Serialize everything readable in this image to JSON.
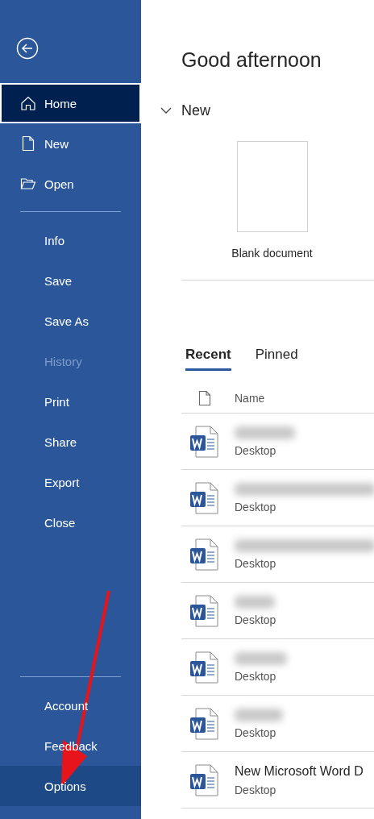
{
  "sidebar": {
    "back": {
      "kind": "back"
    },
    "top_items": [
      {
        "label": "Home",
        "selected": true,
        "disabled": false,
        "hovered": false
      },
      {
        "label": "New",
        "selected": false,
        "disabled": false,
        "hovered": false
      },
      {
        "label": "Open",
        "selected": false,
        "disabled": false,
        "hovered": false
      }
    ],
    "middle_items": [
      {
        "label": "Info",
        "selected": false,
        "disabled": false,
        "hovered": false
      },
      {
        "label": "Save",
        "selected": false,
        "disabled": false,
        "hovered": false
      },
      {
        "label": "Save As",
        "selected": false,
        "disabled": false,
        "hovered": false
      },
      {
        "label": "History",
        "selected": false,
        "disabled": true,
        "hovered": false
      },
      {
        "label": "Print",
        "selected": false,
        "disabled": false,
        "hovered": false
      },
      {
        "label": "Share",
        "selected": false,
        "disabled": false,
        "hovered": false
      },
      {
        "label": "Export",
        "selected": false,
        "disabled": false,
        "hovered": false
      },
      {
        "label": "Close",
        "selected": false,
        "disabled": false,
        "hovered": false
      }
    ],
    "bottom_items": [
      {
        "label": "Account",
        "selected": false,
        "disabled": false,
        "hovered": false
      },
      {
        "label": "Feedback",
        "selected": false,
        "disabled": false,
        "hovered": false
      },
      {
        "label": "Options",
        "selected": false,
        "disabled": false,
        "hovered": true
      }
    ]
  },
  "greeting": "Good afternoon",
  "new_section": {
    "title": "New",
    "expanded": true,
    "templates": [
      {
        "label": "Blank document"
      }
    ]
  },
  "tabs": [
    {
      "label": "Recent",
      "selected": true
    },
    {
      "label": "Pinned",
      "selected": false
    }
  ],
  "file_list": {
    "columns": [
      "Name"
    ],
    "rows": [
      {
        "redacted": true,
        "location": "Desktop"
      },
      {
        "redacted": true,
        "location": "Desktop"
      },
      {
        "redacted": true,
        "location": "Desktop"
      },
      {
        "redacted": true,
        "location": "Desktop"
      },
      {
        "redacted": true,
        "location": "Desktop"
      },
      {
        "redacted": true,
        "location": "Desktop"
      },
      {
        "redacted": false,
        "name": "New Microsoft Word D",
        "location": "Desktop"
      }
    ]
  },
  "annotation": {
    "kind": "arrow"
  }
}
